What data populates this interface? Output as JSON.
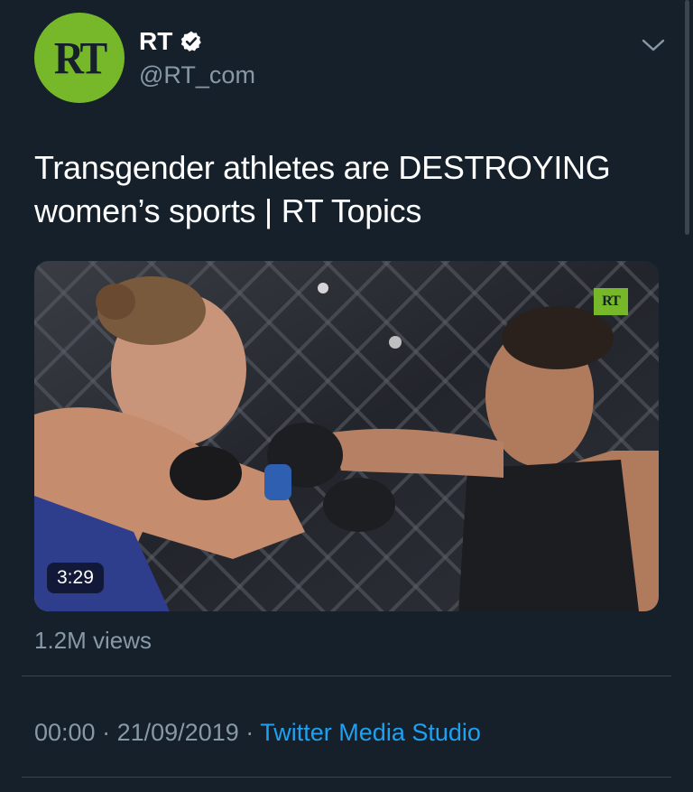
{
  "tweet": {
    "author_name": "RT",
    "author_handle": "@RT_com",
    "avatar_text": "RT",
    "text": "Transgender athletes are DESTROYING women’s sports | RT Topics",
    "media": {
      "duration": "3:29",
      "watermark": "RT"
    },
    "views": "1.2M views",
    "time": "00:00",
    "separator": "·",
    "date": "21/09/2019",
    "source": "Twitter Media Studio"
  },
  "colors": {
    "background": "#15202b",
    "accent": "#1da1f2",
    "secondary_text": "#8899a6",
    "avatar": "#77b82a"
  },
  "icons": [
    "verified-badge-icon",
    "chevron-down-icon"
  ]
}
